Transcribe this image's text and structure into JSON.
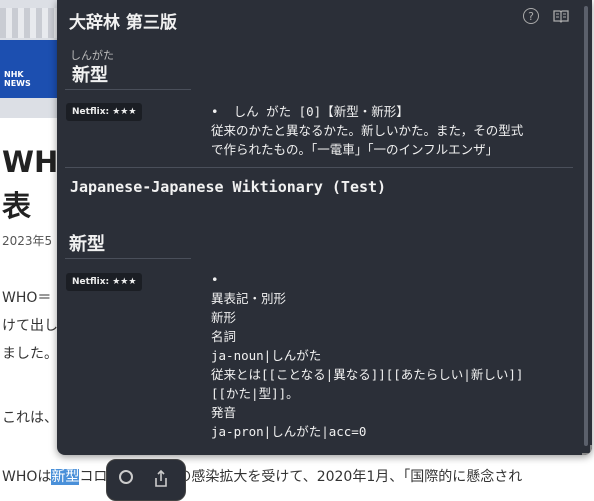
{
  "article": {
    "image_logo": "NHK\nNEWS",
    "title": "WH\n表",
    "date": "2023年5",
    "paragraphs": [
      "WHO＝",
      "けて出し",
      "ました。",
      "これは、"
    ],
    "bottom_line_prefix": "WHOは",
    "bottom_line_highlight": "新型",
    "bottom_line_suffix": "コロナウイルスの感染拡大を受けて、2020年1月、「国際的に懸念され"
  },
  "popup": {
    "dictionary1": {
      "name": "大辞林 第三版",
      "reading": "しんがた",
      "headword": "新型",
      "tag": "Netflix: ★★★",
      "definition": "•  しん がた [0]【新型・新形】\n従来のかたと異なるかた。新しいかた。また，その型式\nで作られたもの。「一電車」「一のインフルエンザ」"
    },
    "dictionary2": {
      "name": "Japanese-Japanese Wiktionary (Test)",
      "headword": "新型",
      "tag": "Netflix: ★★★",
      "definition": "•\n異表記・別形\n新形\n名詞\nja-noun|しんがた\n従来とは[[ことなる|異なる]][[あたらしい|新しい]]\n[[かた|型]]。\n発音\nja-pron|しんがた|acc=0"
    },
    "icons": {
      "help": "help-icon",
      "book": "book-icon"
    }
  },
  "toolbar": {
    "search_icon": "search-icon",
    "share_icon": "share-icon"
  }
}
